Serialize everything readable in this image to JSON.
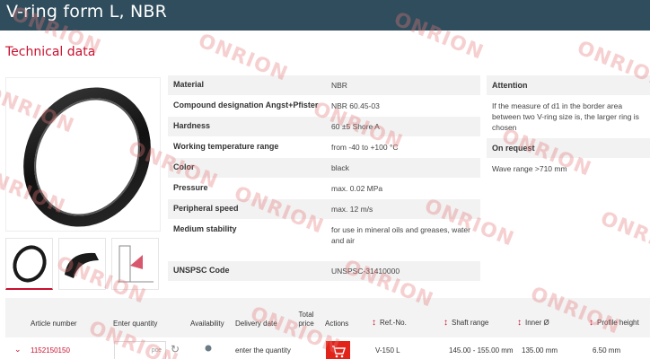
{
  "header": {
    "title": "V-ring form L, NBR"
  },
  "section": {
    "title": "Technical data"
  },
  "specs": [
    {
      "key": "Material",
      "value": "NBR"
    },
    {
      "key": "Compound designation Angst+Pfister",
      "value": "NBR 60.45-03"
    },
    {
      "key": "Hardness",
      "value": "60 ±5 Shore A"
    },
    {
      "key": "Working temperature range",
      "value": "from -40 to +100 °C"
    },
    {
      "key": "Color",
      "value": "black"
    },
    {
      "key": "Pressure",
      "value": "max. 0.02 MPa"
    },
    {
      "key": "Peripheral speed",
      "value": "max. 12 m/s"
    },
    {
      "key": "Medium stability",
      "value": "for use in mineral oils and greases, water and air"
    },
    {
      "key": "UNSPSC Code",
      "value": "UNSPSC-31410000"
    }
  ],
  "side": {
    "attention_title": "Attention",
    "attention_text": "If the measure of d1 in the border area between two V-ring size is, the larger ring is chosen",
    "request_title": "On request",
    "request_text": "Wave range >710 mm"
  },
  "table": {
    "headers": {
      "article": "Article number",
      "quantity": "Enter quantity",
      "availability": "Availability",
      "delivery": "Delivery date",
      "total": "Total price",
      "actions": "Actions",
      "ref": "Ref.-No.",
      "shaft": "Shaft range",
      "inner": "Inner Ø",
      "profile": "Profile height"
    },
    "row": {
      "article": "1152150150",
      "qty_unit": "pce",
      "delivery": "enter the quantity",
      "ref": "V-150 L",
      "shaft": "145.00 - 155.00 mm",
      "inner": "135.00 mm",
      "profile": "6.50 mm"
    }
  },
  "watermark": "ONRION",
  "colors": {
    "header_bg": "#2f4d5c",
    "accent": "#c8102e",
    "cart": "#e2231a"
  },
  "icons": {
    "expand": "chevron-down-icon",
    "refresh": "refresh-icon",
    "availability": "dot-icon",
    "cart": "cart-icon",
    "sort": "sort-arrows-icon"
  }
}
